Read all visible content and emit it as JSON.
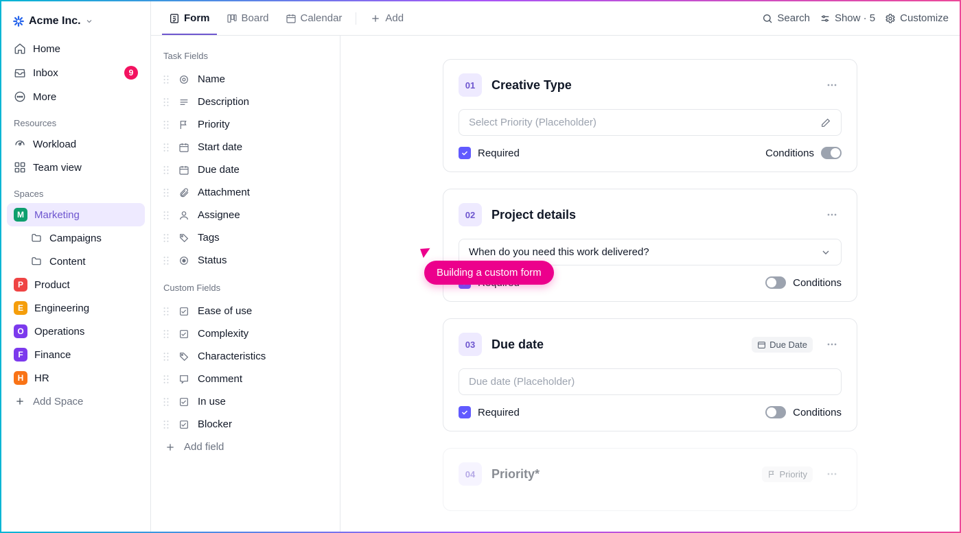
{
  "org": {
    "name": "Acme Inc."
  },
  "nav": {
    "home": "Home",
    "inbox": "Inbox",
    "inbox_count": "9",
    "more": "More"
  },
  "sections": {
    "resources": "Resources",
    "spaces": "Spaces"
  },
  "resources": {
    "workload": "Workload",
    "team_view": "Team view"
  },
  "spaces": [
    {
      "initial": "M",
      "label": "Marketing",
      "color": "#0e9f6e",
      "active": true,
      "children": [
        "Campaigns",
        "Content"
      ]
    },
    {
      "initial": "P",
      "label": "Product",
      "color": "#ef4444"
    },
    {
      "initial": "E",
      "label": "Engineering",
      "color": "#f59e0b"
    },
    {
      "initial": "O",
      "label": "Operations",
      "color": "#7c3aed"
    },
    {
      "initial": "F",
      "label": "Finance",
      "color": "#7c3aed"
    },
    {
      "initial": "H",
      "label": "HR",
      "color": "#f97316"
    }
  ],
  "add_space": "Add Space",
  "views": {
    "form": "Form",
    "board": "Board",
    "calendar": "Calendar",
    "add": "Add"
  },
  "top_actions": {
    "search": "Search",
    "show": "Show · 5",
    "customize": "Customize"
  },
  "fields": {
    "task_header": "Task Fields",
    "custom_header": "Custom Fields",
    "task": [
      "Name",
      "Description",
      "Priority",
      "Start date",
      "Due date",
      "Attachment",
      "Assignee",
      "Tags",
      "Status"
    ],
    "custom": [
      "Ease of use",
      "Complexity",
      "Characteristics",
      "Comment",
      "In use",
      "Blocker"
    ],
    "add": "Add field"
  },
  "cards": [
    {
      "num": "01",
      "title": "Creative Type",
      "input": "Select Priority (Placeholder)",
      "placeholder": true,
      "trailing_icon": "pencil",
      "required": "Required",
      "conditions": "Conditions",
      "toggle_on": true,
      "toggle_side": "right"
    },
    {
      "num": "02",
      "title": "Project details",
      "input": "When do you need this work delivered?",
      "placeholder": false,
      "trailing_icon": "chevron",
      "required": "Required",
      "conditions": "Conditions",
      "toggle_on": false,
      "toggle_side": "left"
    },
    {
      "num": "03",
      "title": "Due date",
      "tag": "Due Date",
      "tag_icon": "calendar",
      "input": "Due date (Placeholder)",
      "placeholder": true,
      "required": "Required",
      "conditions": "Conditions",
      "toggle_on": false,
      "toggle_side": "left"
    },
    {
      "num": "04",
      "title": "Priority*",
      "tag": "Priority",
      "tag_icon": "flag",
      "fade": true
    }
  ],
  "cursor_label": "Building a custom form"
}
